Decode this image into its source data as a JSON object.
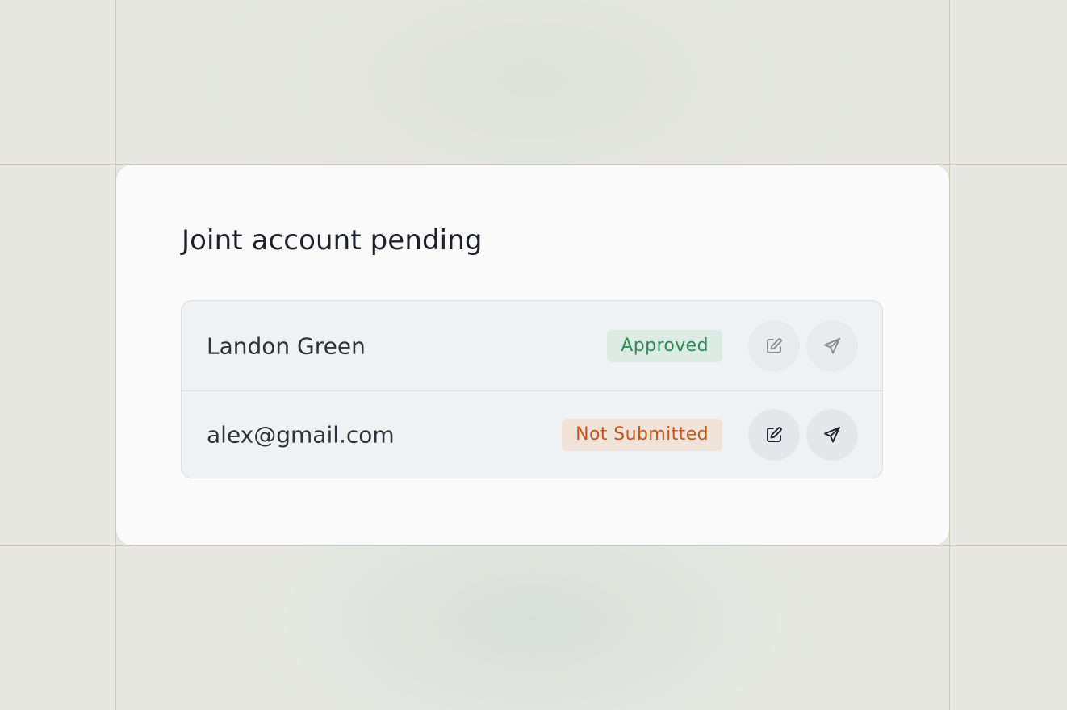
{
  "card": {
    "title": "Joint account pending"
  },
  "rows": [
    {
      "label": "Landon Green",
      "status": "Approved",
      "status_color": "#2e8a58",
      "actions_enabled": false,
      "actions": [
        "edit-icon",
        "send-icon"
      ]
    },
    {
      "label": "alex@gmail.com",
      "status": "Not Submitted",
      "status_color": "#c1571b",
      "actions_enabled": true,
      "actions": [
        "edit-icon",
        "send-icon"
      ]
    }
  ],
  "colors": {
    "approved_badge_bg": "#dcebe3",
    "not_submitted_badge_bg": "#f0e3da",
    "title_text": "#1d1f2a"
  }
}
